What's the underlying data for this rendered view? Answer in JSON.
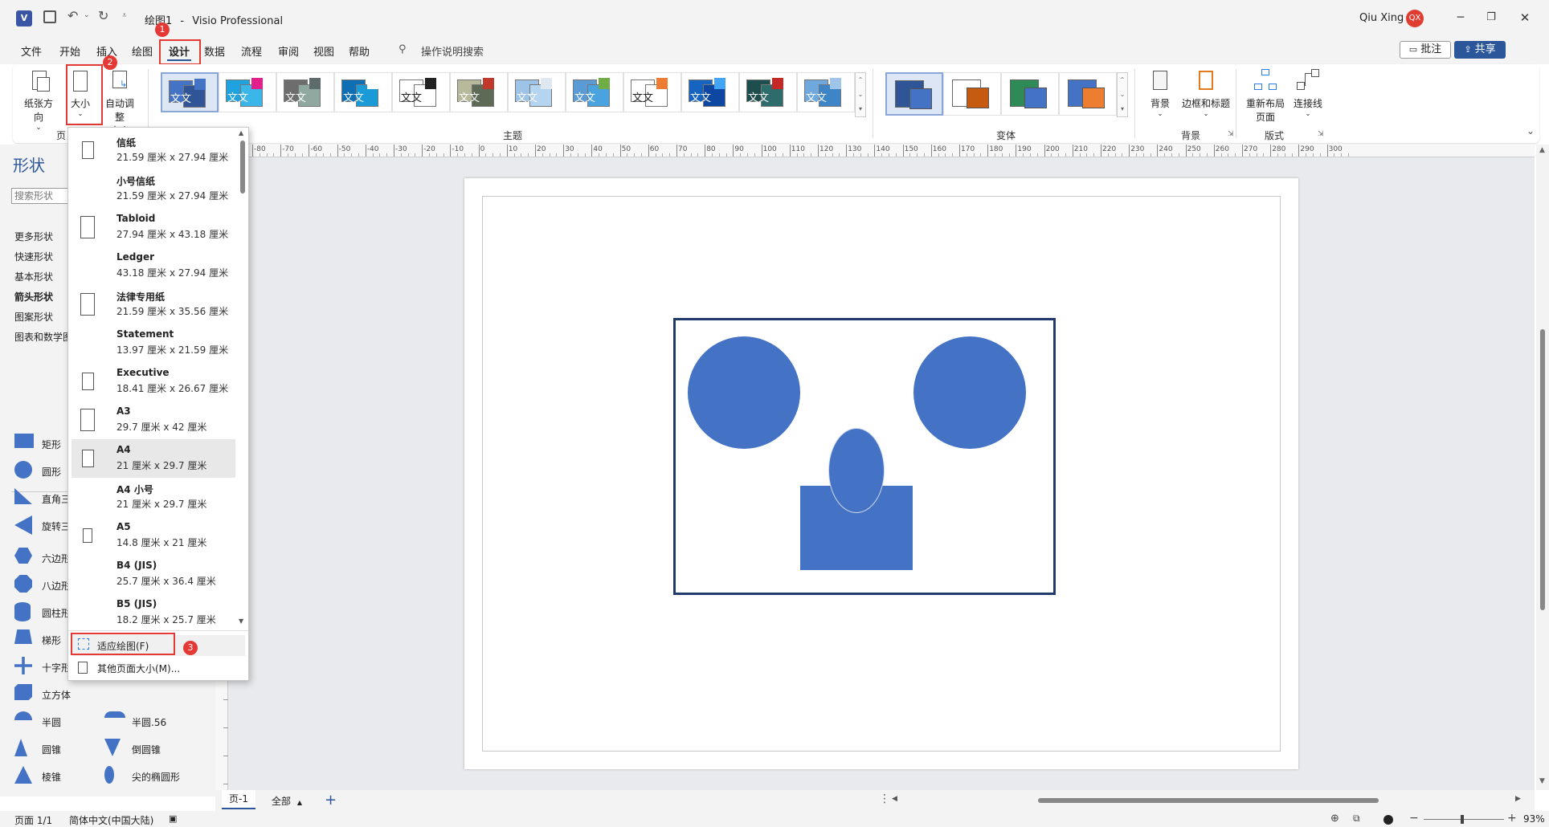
{
  "app": {
    "doc_title": "绘图1",
    "separator": "-",
    "app_name": "Visio Professional",
    "user_name": "Qiu Xing",
    "user_initials": "QX",
    "accent": "#2b579a",
    "avatar_color": "#e03c31"
  },
  "menu": {
    "items": [
      "文件",
      "开始",
      "插入",
      "绘图",
      "设计",
      "数据",
      "流程",
      "审阅",
      "视图",
      "帮助"
    ],
    "active": "设计",
    "search_label": "操作说明搜索",
    "comments_label": "批注",
    "share_label": "共享"
  },
  "ribbon": {
    "orientation_label": "纸张方向",
    "size_label": "大小",
    "autosize_label_1": "自动调整",
    "autosize_label_2": "大小",
    "page_setup_group": "页",
    "themes_group": "主题",
    "variants_group": "变体",
    "background_group": "背景",
    "layout_group": "版式",
    "theme_text": "文文",
    "background_label": "背景",
    "borders_label": "边框和标题",
    "relayout_label_1": "重新布局",
    "relayout_label_2": "页面",
    "connectors_label": "连接线",
    "themes": [
      {
        "c1": "#4472c4",
        "c2": "#2f5597",
        "c3": "#4472c4"
      },
      {
        "c1": "#1fa3e0",
        "c2": "#3ab7e8",
        "c3": "#e31f8c"
      },
      {
        "c1": "#6d6d6d",
        "c2": "#8fa8a0",
        "c3": "#5d6b6b"
      },
      {
        "c1": "#0f6fb5",
        "c2": "#1a9ad6",
        "c3": "#ffffff"
      },
      {
        "c1": "#ffffff",
        "c2": "#ffffff",
        "c3": "#222222"
      },
      {
        "c1": "#b8b89a",
        "c2": "#5d6b56",
        "c3": "#c0392b"
      },
      {
        "c1": "#9dc3e6",
        "c2": "#b4d4ef",
        "c3": "#dfe8f0"
      },
      {
        "c1": "#5b9bd5",
        "c2": "#4aa3df",
        "c3": "#70ad47"
      },
      {
        "c1": "#ffffff",
        "c2": "#ffffff",
        "c3": "#ed7d31"
      },
      {
        "c1": "#1565c0",
        "c2": "#0d47a1",
        "c3": "#42a5f5"
      },
      {
        "c1": "#1e4d4d",
        "c2": "#2e6b6b",
        "c3": "#c62828"
      },
      {
        "c1": "#6fa8dc",
        "c2": "#3d85c6",
        "c3": "#9fc5e8"
      }
    ],
    "variants": [
      {
        "c1": "#2f5597",
        "c2": "#4472c4"
      },
      {
        "c1": "#ffffff",
        "c2": "#c55a11"
      },
      {
        "c1": "#2e8b57",
        "c2": "#4472c4"
      },
      {
        "c1": "#4472c4",
        "c2": "#ed7d31"
      }
    ]
  },
  "shapes_panel": {
    "title": "形状",
    "search_placeholder": "搜索形状",
    "categories": [
      "更多形状",
      "快速形状",
      "基本形状",
      "箭头形状",
      "图案形状",
      "图表和数学图"
    ],
    "active_category": "箭头形状",
    "items_left": [
      "矩形",
      "圆形",
      "直角三",
      "旋转三",
      "六边形",
      "八边形",
      "圆柱形",
      "梯形",
      "十字形",
      "立方体",
      "半圆",
      "圆锥",
      "棱锥"
    ],
    "items_right": [
      "半圆.56",
      "倒圆锥",
      "尖的椭圆形"
    ],
    "shape_color": "#4472c4"
  },
  "size_dropdown": {
    "rows": [
      {
        "name": "信纸",
        "dims": "21.59 厘米 x 27.94 厘米",
        "orient": "portrait"
      },
      {
        "name": "小号信纸",
        "dims": "21.59 厘米 x 27.94 厘米",
        "orient": "none"
      },
      {
        "name": "Tabloid",
        "dims": "27.94 厘米 x 43.18 厘米",
        "orient": "portrait"
      },
      {
        "name": "Ledger",
        "dims": "43.18 厘米 x 27.94 厘米",
        "orient": "none"
      },
      {
        "name": "法律专用纸",
        "dims": "21.59 厘米 x 35.56 厘米",
        "orient": "portrait"
      },
      {
        "name": "Statement",
        "dims": "13.97 厘米 x 21.59 厘米",
        "orient": "none"
      },
      {
        "name": "Executive",
        "dims": "18.41 厘米 x 26.67 厘米",
        "orient": "portrait"
      },
      {
        "name": "A3",
        "dims": "29.7 厘米 x 42 厘米",
        "orient": "portrait"
      },
      {
        "name": "A4",
        "dims": "21 厘米 x 29.7 厘米",
        "orient": "portrait"
      },
      {
        "name": "A4 小号",
        "dims": "21 厘米 x 29.7 厘米",
        "orient": "none"
      },
      {
        "name": "A5",
        "dims": "14.8 厘米 x 21 厘米",
        "orient": "portrait"
      },
      {
        "name": "B4 (JIS)",
        "dims": "25.7 厘米 x 36.4 厘米",
        "orient": "none"
      },
      {
        "name": "B5 (JIS)",
        "dims": "18.2 厘米 x 25.7 厘米",
        "orient": "none"
      }
    ],
    "selected": "A4",
    "fit_to_drawing": "适应绘图(F)",
    "more_sizes": "其他页面大小(M)..."
  },
  "annotations": [
    "1",
    "2",
    "3"
  ],
  "ruler": {
    "ticks": [
      "-80",
      "-70",
      "-60",
      "-50",
      "-40",
      "-30",
      "-20",
      "-10",
      "0",
      "10",
      "20",
      "30",
      "40",
      "50",
      "60",
      "70",
      "80",
      "90",
      "100",
      "110",
      "120",
      "130",
      "140",
      "150",
      "160",
      "170",
      "180",
      "190",
      "200",
      "210",
      "220",
      "230",
      "240",
      "250",
      "260",
      "270",
      "280",
      "290",
      "300"
    ]
  },
  "tabs": {
    "page_tab": "页-1",
    "all_label": "全部"
  },
  "status": {
    "page_info": "页面 1/1",
    "language": "简体中文(中国大陆)",
    "zoom": "93%"
  },
  "drawing": {
    "fill": "#4472c4",
    "frame": "#1f3a6b"
  }
}
